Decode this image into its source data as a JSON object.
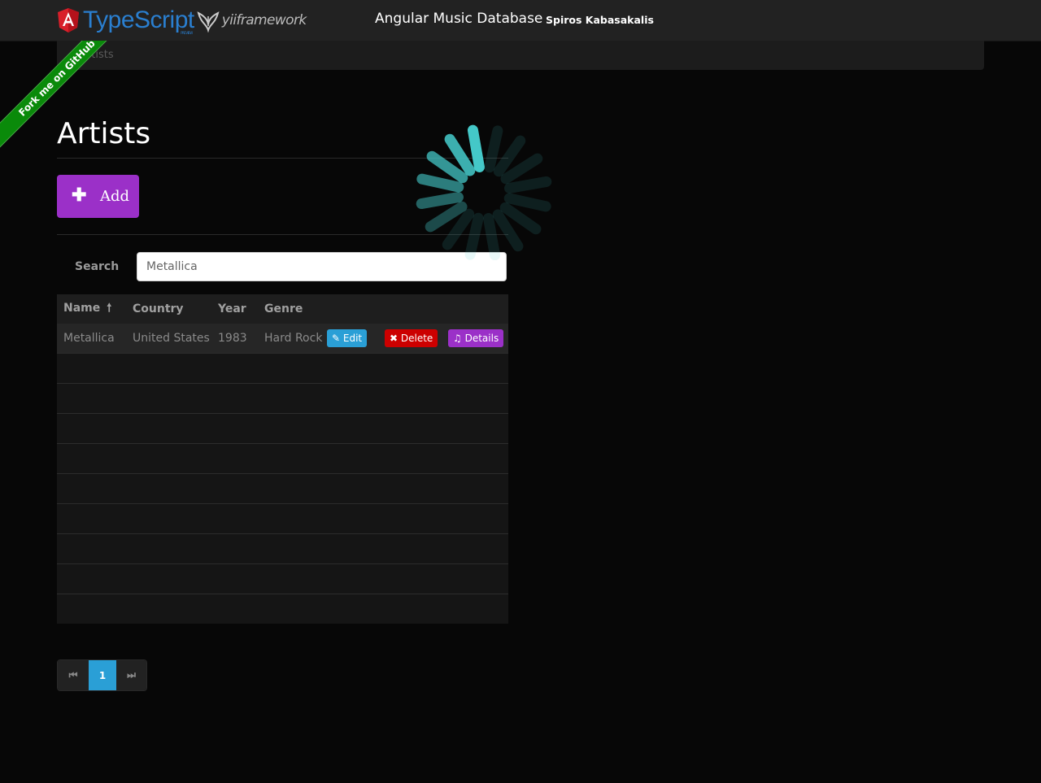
{
  "navbar": {
    "logos": {
      "typescript": "TypeScript",
      "typescript_sub": "PREVIEW",
      "yii": "yiiframework"
    },
    "title": "Angular Music Database",
    "author_link": "Spiros Kabasakalis"
  },
  "breadcrumb": {
    "current": "Artists"
  },
  "ribbon": {
    "label": "Fork me on GitHub",
    "color": "#0a8a0a"
  },
  "page": {
    "title": "Artists"
  },
  "toolbar": {
    "add_label": "Add",
    "add_icon": "plus-icon"
  },
  "search": {
    "label": "Search",
    "value": "Metallica"
  },
  "table": {
    "columns": [
      "Name",
      "Country",
      "Year",
      "Genre"
    ],
    "sort_column": "Name",
    "sort_direction": "ascending",
    "rows": [
      {
        "name": "Metallica",
        "country": "United States",
        "year": "1983",
        "genre": "Hard Rock",
        "actions": {
          "edit": "Edit",
          "delete": "Delete",
          "details": "Details"
        }
      }
    ]
  },
  "pagination": {
    "current_page": "1",
    "first_icon": "first-page-icon",
    "last_icon": "last-page-icon"
  },
  "colors": {
    "accent_purple": "#9b30c8",
    "accent_blue": "#2a9fd6",
    "danger_red": "#cc0000",
    "spinner": "#44c8c8"
  },
  "loading_spinner": {
    "visible": true
  }
}
